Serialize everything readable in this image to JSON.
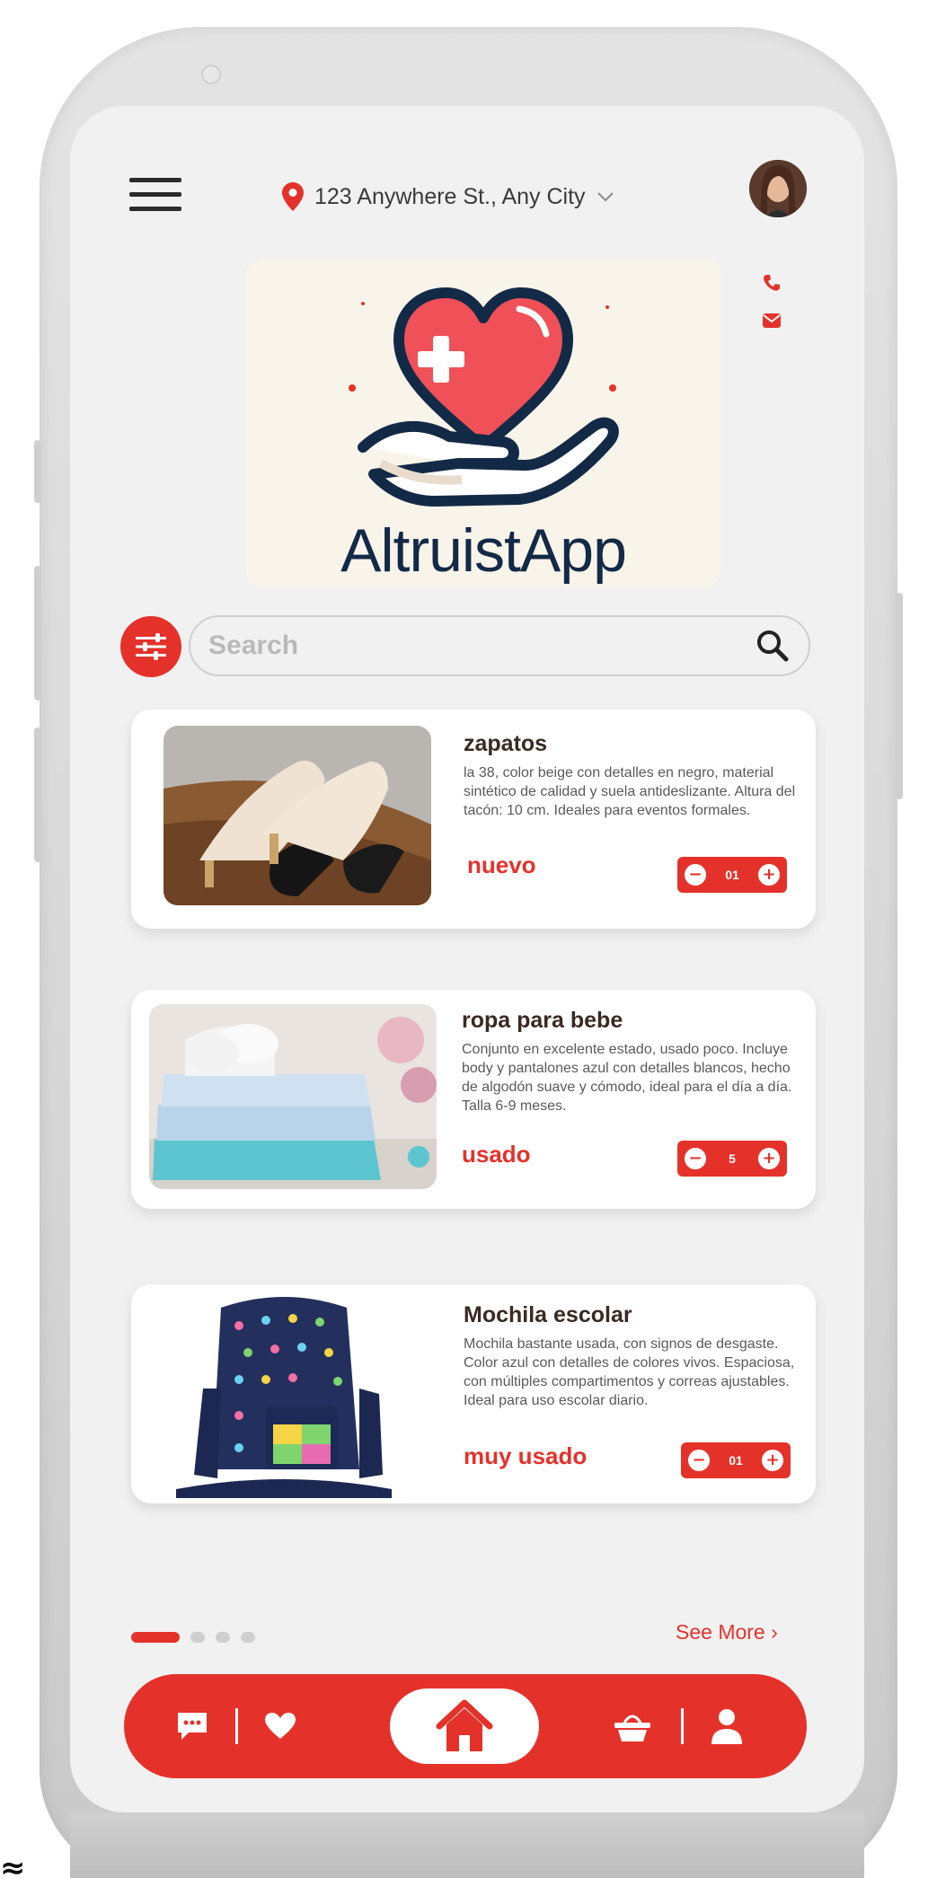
{
  "header": {
    "location": "123 Anywhere St., Any City"
  },
  "brand": {
    "name": "AltruistApp"
  },
  "search": {
    "placeholder": "Search"
  },
  "items": [
    {
      "title": "zapatos",
      "description": "la 38, color beige con detalles en negro, material sintético de calidad y suela antideslizante. Altura del tacón: 10 cm. Ideales para eventos formales.",
      "condition": "nuevo",
      "quantity": "01"
    },
    {
      "title": "ropa para bebe",
      "description": "Conjunto en excelente estado, usado poco. Incluye body y pantalones azul con detalles blancos, hecho de algodón suave y cómodo, ideal para el día a día. Talla 6-9 meses.",
      "condition": "usado",
      "quantity": "5"
    },
    {
      "title": "Mochila escolar",
      "description": "Mochila bastante usada, con signos de desgaste. Color azul con detalles de colores vivos. Espaciosa, con múltiples compartimentos y correas ajustables. Ideal para uso escolar diario.",
      "condition": "muy usado",
      "quantity": "01"
    }
  ],
  "footer": {
    "see_more": "See More",
    "pages": 4,
    "active_page": 1
  },
  "nav": {
    "icons": [
      "chat-icon",
      "heart-icon",
      "home-icon",
      "basket-icon",
      "profile-icon"
    ]
  },
  "colors": {
    "accent": "#e4322b",
    "background": "#f1f1f1",
    "card": "#ffffff",
    "logo_text": "#132a47"
  }
}
